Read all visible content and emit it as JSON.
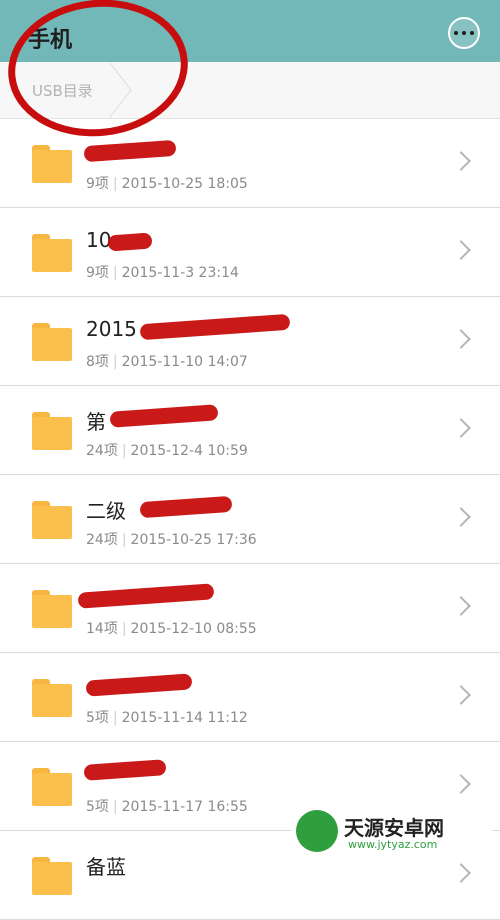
{
  "header": {
    "title": "手机",
    "more_icon": "more-icon"
  },
  "breadcrumb": {
    "label": "USB目录"
  },
  "folders": [
    {
      "name": "",
      "count": "9项",
      "date": "2015-10-25 18:05"
    },
    {
      "name": "10",
      "count": "9项",
      "date": "2015-11-3 23:14"
    },
    {
      "name": "2015",
      "count": "8项",
      "date": "2015-11-10 14:07"
    },
    {
      "name": "第",
      "count": "24项",
      "date": "2015-12-4 10:59"
    },
    {
      "name": "二级",
      "count": "24项",
      "date": "2015-10-25 17:36"
    },
    {
      "name": "",
      "count": "14项",
      "date": "2015-12-10 08:55"
    },
    {
      "name": "",
      "count": "5项",
      "date": "2015-11-14 11:12"
    },
    {
      "name": "",
      "count": "5项",
      "date": "2015-11-17 16:55"
    },
    {
      "name": "备蓝",
      "count": "",
      "date": ""
    }
  ],
  "watermark": {
    "text": "天源安卓网",
    "url": "www.jytyaz.com"
  },
  "colors": {
    "header": "#72b8b8",
    "folder": "#fbbf4b",
    "annotation": "#c70d0d"
  }
}
